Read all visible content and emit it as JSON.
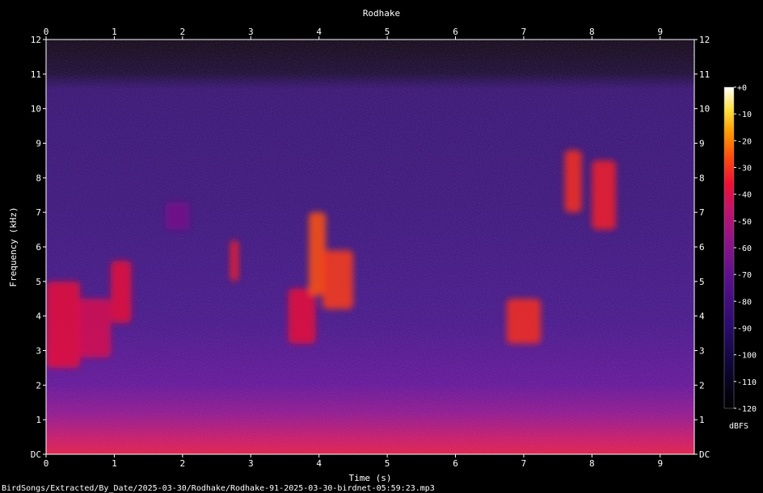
{
  "chart_data": {
    "type": "heatmap",
    "title": "Rodhake",
    "xlabel": "Time (s)",
    "ylabel": "Frequency (kHz)",
    "xlim": [
      0,
      9.5
    ],
    "ylim": [
      0,
      12
    ],
    "x_ticks": [
      "0",
      "1",
      "2",
      "3",
      "4",
      "5",
      "6",
      "7",
      "8",
      "9"
    ],
    "y_ticks": [
      "DC",
      "1",
      "2",
      "3",
      "4",
      "5",
      "6",
      "7",
      "8",
      "9",
      "10",
      "11",
      "12"
    ],
    "colorbar": {
      "label": "dBFS",
      "range": [
        -120,
        0
      ],
      "ticks": [
        "+0",
        "-10",
        "-20",
        "-30",
        "-40",
        "-50",
        "-60",
        "-70",
        "-80",
        "-90",
        "-100",
        "-110",
        "-120"
      ]
    },
    "grid": false,
    "bursts": [
      {
        "t0": 0.0,
        "t1": 0.5,
        "f0": 2.5,
        "f1": 5.0,
        "dbfs": -45
      },
      {
        "t0": 0.45,
        "t1": 0.95,
        "f0": 2.8,
        "f1": 4.5,
        "dbfs": -48
      },
      {
        "t0": 0.95,
        "t1": 1.25,
        "f0": 3.8,
        "f1": 5.6,
        "dbfs": -45
      },
      {
        "t0": 1.75,
        "t1": 2.1,
        "f0": 6.5,
        "f1": 7.3,
        "dbfs": -68
      },
      {
        "t0": 2.7,
        "t1": 2.82,
        "f0": 5.0,
        "f1": 6.2,
        "dbfs": -42
      },
      {
        "t0": 3.55,
        "t1": 3.95,
        "f0": 3.2,
        "f1": 4.8,
        "dbfs": -45
      },
      {
        "t0": 3.85,
        "t1": 4.1,
        "f0": 4.6,
        "f1": 7.0,
        "dbfs": -35
      },
      {
        "t0": 4.05,
        "t1": 4.5,
        "f0": 4.2,
        "f1": 5.9,
        "dbfs": -38
      },
      {
        "t0": 6.75,
        "t1": 7.25,
        "f0": 3.2,
        "f1": 4.5,
        "dbfs": -40
      },
      {
        "t0": 7.6,
        "t1": 7.85,
        "f0": 7.0,
        "f1": 8.8,
        "dbfs": -40
      },
      {
        "t0": 8.0,
        "t1": 8.35,
        "f0": 6.5,
        "f1": 8.5,
        "dbfs": -42
      }
    ]
  },
  "footer": {
    "path": "BirdSongs/Extracted/By_Date/2025-03-30/Rodhake/Rodhake-91-2025-03-30-birdnet-05:59:23.mp3"
  }
}
